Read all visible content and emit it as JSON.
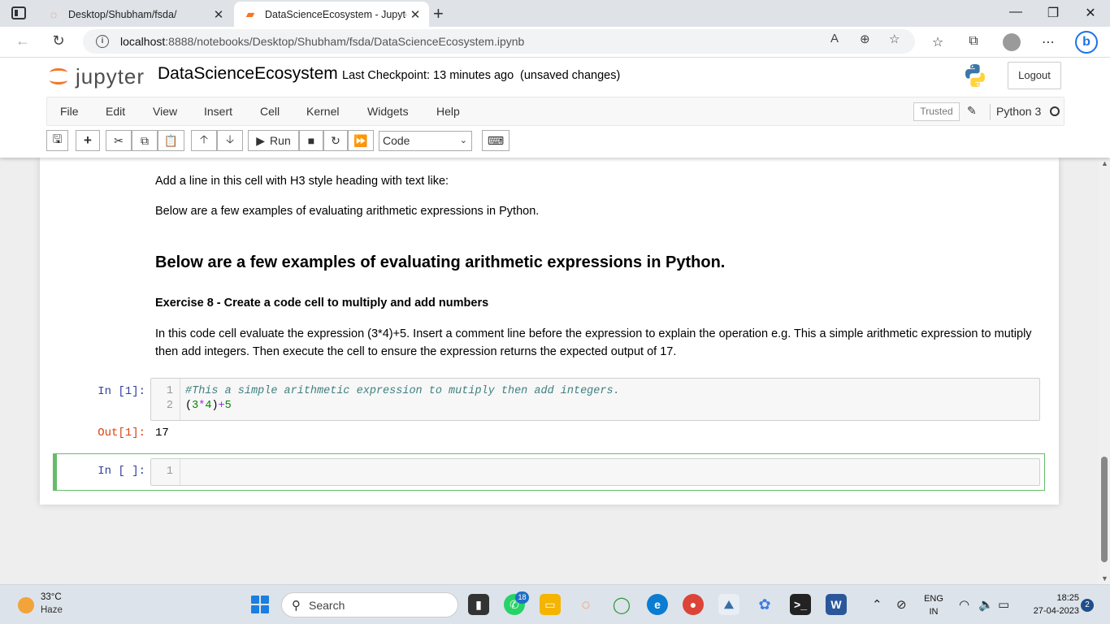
{
  "browser": {
    "tabs": [
      {
        "title": "Desktop/Shubham/fsda/",
        "active": false
      },
      {
        "title": "DataScienceEcosystem - Jupyter",
        "active": true
      }
    ],
    "url_host": "localhost",
    "url_path": ":8888/notebooks/Desktop/Shubham/fsda/DataScienceEcosystem.ipynb",
    "accent": "#1a73e8"
  },
  "jupyter": {
    "logo_text": "jupyter",
    "notebook_name": "DataScienceEcosystem",
    "checkpoint": "Last Checkpoint: 13 minutes ago",
    "unsaved": "(unsaved changes)",
    "logout_label": "Logout",
    "menu": [
      "File",
      "Edit",
      "View",
      "Insert",
      "Cell",
      "Kernel",
      "Widgets",
      "Help"
    ],
    "trusted_label": "Trusted",
    "kernel_name": "Python 3",
    "toolbar": {
      "run_label": "Run",
      "cell_type": "Code"
    }
  },
  "notebook": {
    "md_line1": "Add a line in this cell with H3 style heading with text like:",
    "md_line2": "Below are a few examples of evaluating arithmetic expressions in Python.",
    "h3": "Below are a few examples of evaluating arithmetic expressions in Python.",
    "h4": "Exercise 8 - Create a code cell to multiply and add numbers",
    "paragraph": "In this code cell evaluate the expression (3*4)+5. Insert a comment line before the expression to explain the operation e.g. This a simple arithmetic expression to mutiply then add integers. Then execute the cell to ensure the expression returns the expected output of 17.",
    "cell1": {
      "prompt": "In [1]:",
      "line_numbers": [
        "1",
        "2"
      ],
      "comment": "#This a simple arithmetic expression to mutiply then add integers.",
      "code_parts": [
        "(",
        "3",
        "*",
        "4",
        ")",
        "+",
        "5"
      ]
    },
    "out1": {
      "prompt": "Out[1]:",
      "value": "17"
    },
    "cell2": {
      "prompt": "In [ ]:",
      "line_numbers": [
        "1"
      ]
    }
  },
  "taskbar": {
    "weather_temp": "33°C",
    "weather_cond": "Haze",
    "search_label": "Search",
    "whatsapp_badge": "18",
    "lang_line1": "ENG",
    "lang_line2": "IN",
    "time": "18:25",
    "date": "27-04-2023",
    "notification_count": "2"
  }
}
